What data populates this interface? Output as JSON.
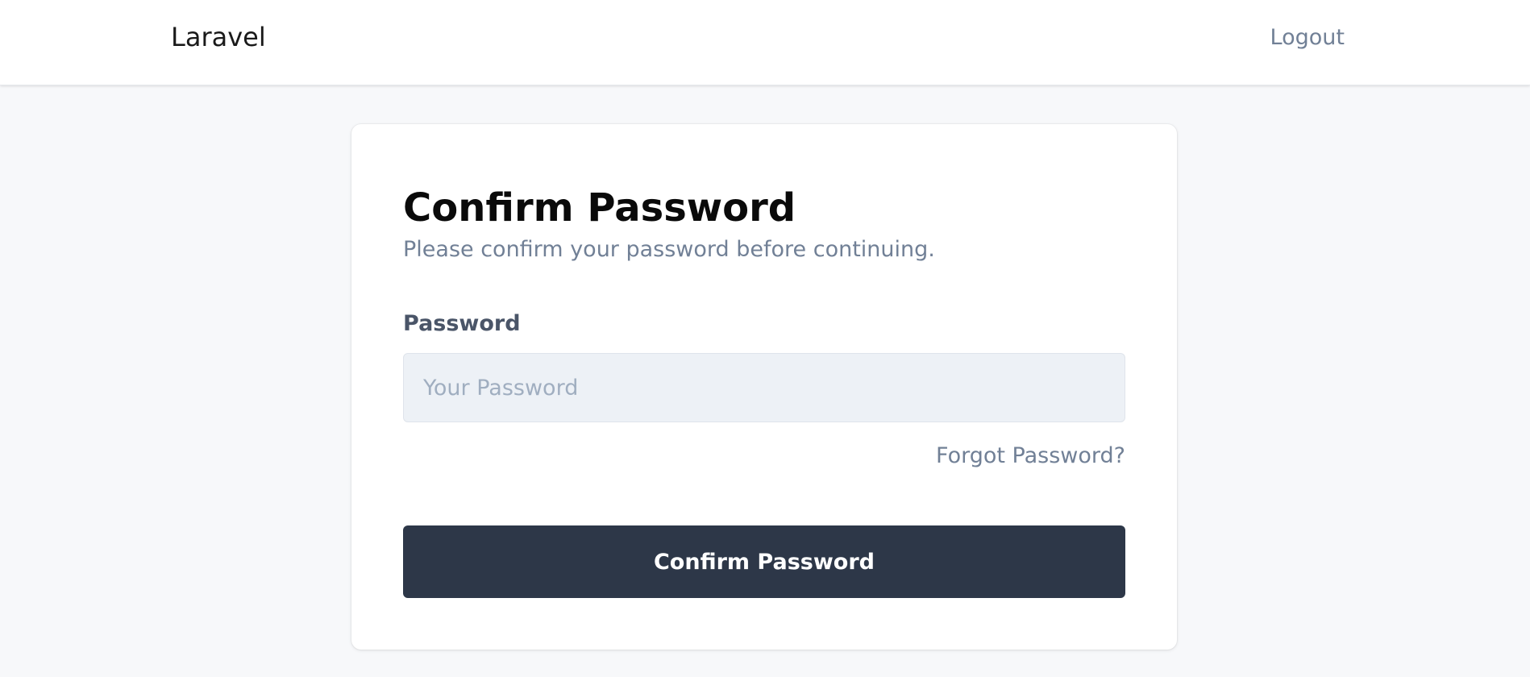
{
  "navbar": {
    "brand": "Laravel",
    "logout_label": "Logout"
  },
  "card": {
    "title": "Confirm Password",
    "subtitle": "Please confirm your password before continuing.",
    "password_label": "Password",
    "password_placeholder": "Your Password",
    "password_value": "",
    "forgot_label": "Forgot Password?",
    "submit_label": "Confirm Password"
  },
  "colors": {
    "page_background": "#f7f8fa",
    "button_background": "#2d3748",
    "muted_text": "#718096",
    "input_background": "#edf1f6"
  }
}
